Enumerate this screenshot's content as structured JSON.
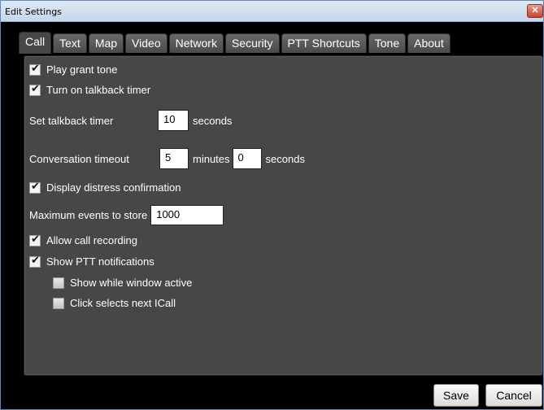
{
  "window": {
    "title": "Edit Settings",
    "close_glyph": "✕"
  },
  "tabs": [
    {
      "label": "Call"
    },
    {
      "label": "Text"
    },
    {
      "label": "Map"
    },
    {
      "label": "Video"
    },
    {
      "label": "Network"
    },
    {
      "label": "Security"
    },
    {
      "label": "PTT Shortcuts"
    },
    {
      "label": "Tone"
    },
    {
      "label": "About"
    }
  ],
  "call": {
    "play_grant_tone": {
      "label": "Play grant tone",
      "checked": true
    },
    "talkback_timer": {
      "label": "Turn on talkback timer",
      "checked": true
    },
    "set_talkback": {
      "label": "Set talkback timer",
      "value": "10",
      "unit": "seconds"
    },
    "conversation_timeout": {
      "label": "Conversation timeout",
      "minutes_value": "5",
      "minutes_unit": "minutes",
      "seconds_value": "0",
      "seconds_unit": "seconds"
    },
    "distress_confirmation": {
      "label": "Display distress confirmation",
      "checked": true
    },
    "max_events": {
      "label": "Maximum events to store",
      "value": "1000"
    },
    "allow_recording": {
      "label": "Allow call recording",
      "checked": true
    },
    "ptt_notifications": {
      "label": "Show PTT notifications",
      "checked": true
    },
    "show_while_active": {
      "label": "Show while window active",
      "checked": false
    },
    "click_selects_next": {
      "label": "Click selects next ICall",
      "checked": false
    }
  },
  "buttons": {
    "save": "Save",
    "cancel": "Cancel"
  }
}
